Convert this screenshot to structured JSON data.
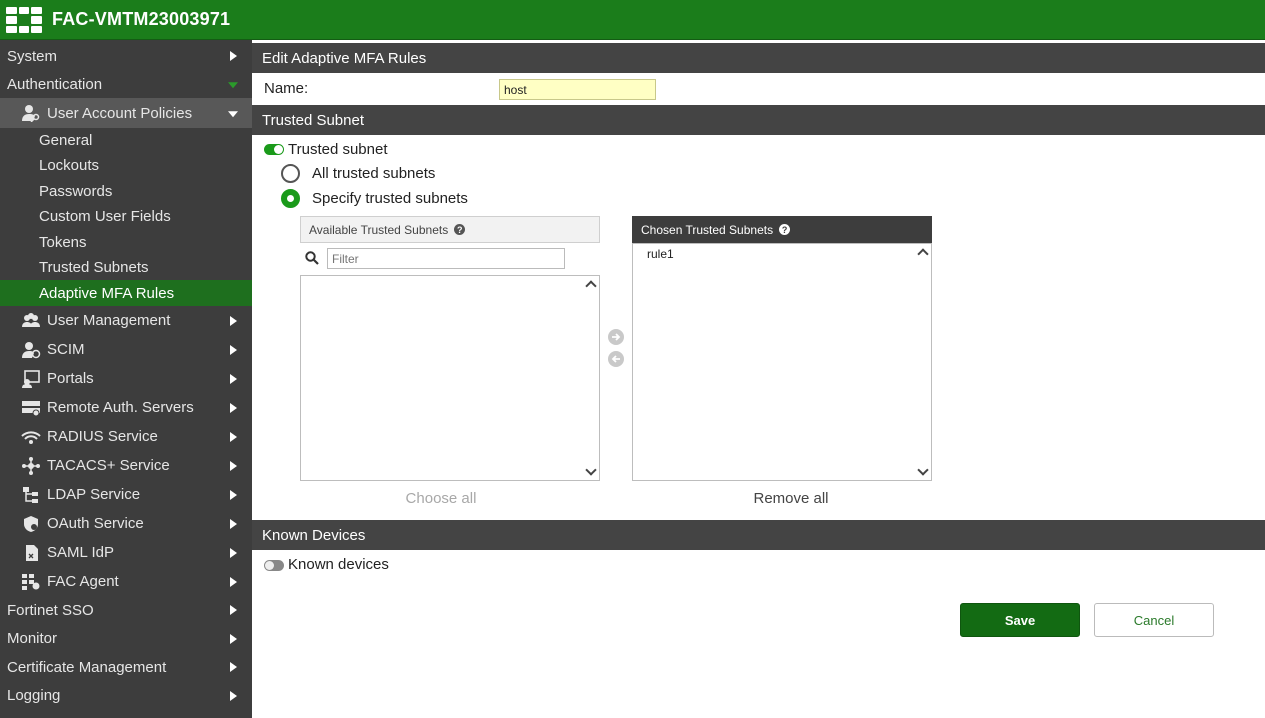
{
  "app": {
    "title": "FAC-VMTM23003971"
  },
  "sidebar": {
    "system": "System",
    "authentication": "Authentication",
    "user_account_policies": "User Account Policies",
    "sub_items": [
      "General",
      "Lockouts",
      "Passwords",
      "Custom User Fields",
      "Tokens",
      "Trusted Subnets",
      "Adaptive MFA Rules"
    ],
    "groups": [
      "User Management",
      "SCIM",
      "Portals",
      "Remote Auth. Servers",
      "RADIUS Service",
      "TACACS+ Service",
      "LDAP Service",
      "OAuth Service",
      "SAML IdP",
      "FAC Agent"
    ],
    "bottom": [
      "Fortinet SSO",
      "Monitor",
      "Certificate Management",
      "Logging"
    ]
  },
  "main": {
    "title": "Edit Adaptive MFA Rules",
    "name_label": "Name:",
    "name_value": "host",
    "trusted_subnet_section": "Trusted Subnet",
    "trusted_subnet_toggle": "Trusted subnet",
    "trusted_subnet_enabled": true,
    "radio_all": "All trusted subnets",
    "radio_specify": "Specify trusted subnets",
    "available_header": "Available Trusted Subnets",
    "chosen_header": "Chosen Trusted Subnets",
    "filter_placeholder": "Filter",
    "chosen_items": [
      "rule1"
    ],
    "choose_all": "Choose all",
    "remove_all": "Remove all",
    "known_devices_section": "Known Devices",
    "known_devices_toggle": "Known devices",
    "known_devices_enabled": false,
    "save": "Save",
    "cancel": "Cancel"
  },
  "colors": {
    "brand_green": "#1b7d1b",
    "sidebar_bg": "#3d3d3d",
    "active_item": "#1e6f1e",
    "section_header": "#444444"
  }
}
